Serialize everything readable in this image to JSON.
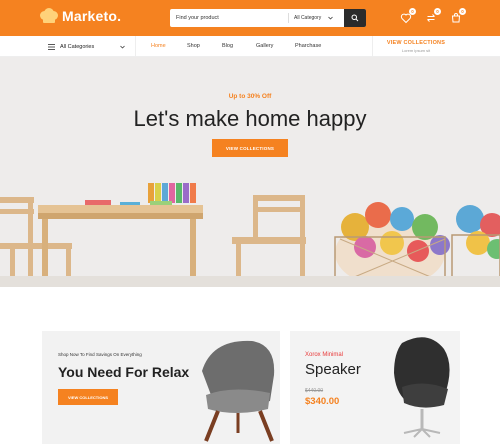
{
  "colors": {
    "accent": "#f58220",
    "dark": "#2b2b2b",
    "sale": "#e83a3a"
  },
  "brand": {
    "name": "Marketo."
  },
  "search": {
    "placeholder": "Find your product",
    "category": "All Category",
    "button_icon": "search-icon"
  },
  "header_icons": [
    {
      "icon": "heart-icon",
      "badge": "0"
    },
    {
      "icon": "compare-icon",
      "badge": "0"
    },
    {
      "icon": "cart-icon",
      "badge": "0"
    }
  ],
  "nav": {
    "all_categories": "All Categories",
    "links": [
      "Home",
      "Shop",
      "Blog",
      "Gallery",
      "Pharchase"
    ],
    "active_link": "Home",
    "view_collections": {
      "title": "VIEW COLLECTIONS",
      "subtitle": "Lorem ipsum sit"
    }
  },
  "hero": {
    "tag": "Up to 30% Off",
    "title": "Let's make home happy",
    "button": "VIEW COLLECTIONS"
  },
  "promo_left": {
    "kicker": "Shop Now To Find Savings On Everything",
    "title": "You Need For Relax",
    "button": "VIEW COLLECTIONS"
  },
  "promo_right": {
    "kicker": "Xorox Minimal",
    "title": "Speaker",
    "old_price": "$440.00",
    "price": "$340.00"
  }
}
